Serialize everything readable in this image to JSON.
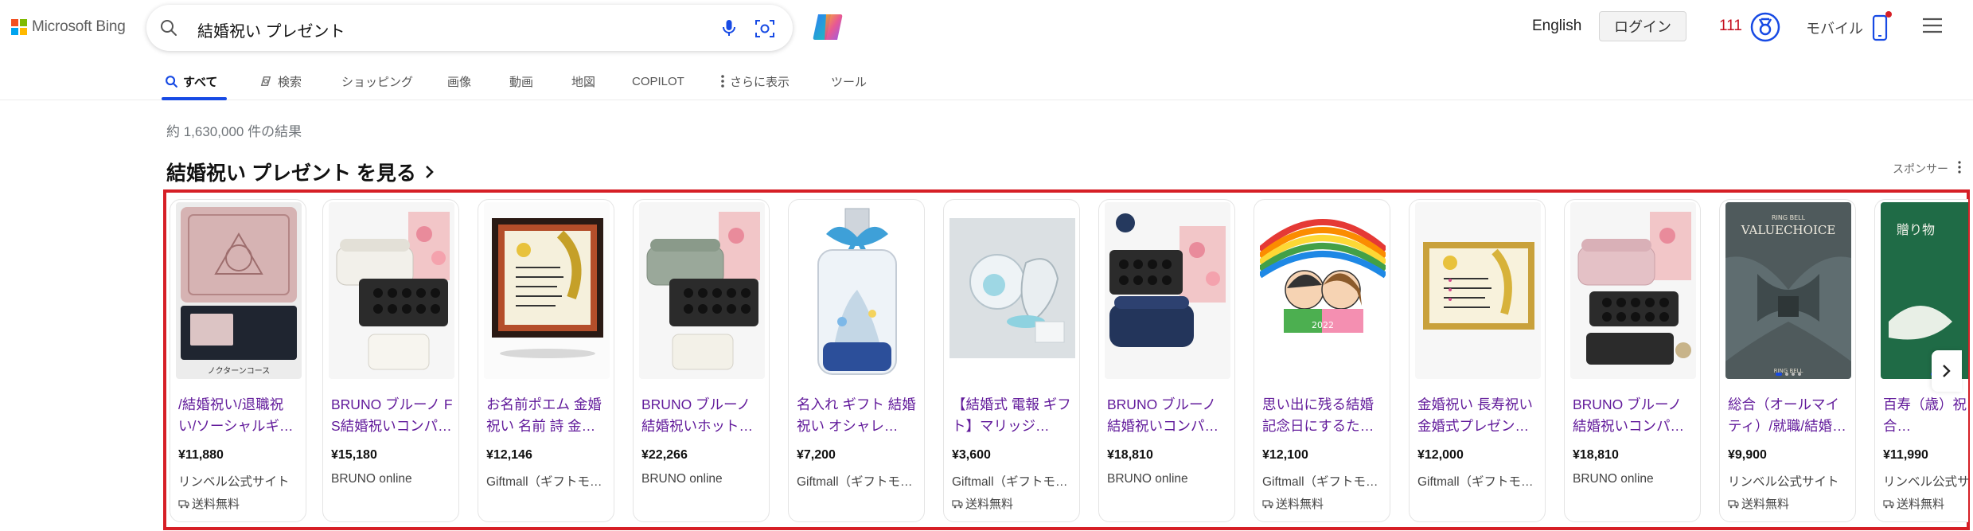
{
  "header": {
    "logo_text": "Microsoft Bing",
    "logo_colors": [
      "#f25022",
      "#7fba00",
      "#00a4ef",
      "#ffb900"
    ],
    "search_query": "結婚祝い プレゼント",
    "language_link": "English",
    "login_label": "ログイン",
    "rewards_count": "111",
    "mobile_label": "モバイル"
  },
  "tabs": [
    {
      "label": "すべて",
      "icon": "search-icon",
      "active": true
    },
    {
      "label": "検索",
      "icon": "copilot-search-icon",
      "active": false
    },
    {
      "label": "ショッピング",
      "icon": "",
      "active": false
    },
    {
      "label": "画像",
      "icon": "",
      "active": false
    },
    {
      "label": "動画",
      "icon": "",
      "active": false
    },
    {
      "label": "地図",
      "icon": "",
      "active": false
    },
    {
      "label": "COPILOT",
      "icon": "",
      "active": false
    },
    {
      "label": "さらに表示",
      "icon": "more-vertical-icon",
      "active": false
    },
    {
      "label": "ツール",
      "icon": "",
      "active": false
    }
  ],
  "results": {
    "count_text": "約 1,630,000 件の結果",
    "shopping_title": "結婚祝い プレゼント を見る",
    "sponsor_label": "スポンサー"
  },
  "products": [
    {
      "title": "/結婚祝い/退職祝い/ソーシャルギフト…",
      "price": "¥11,880",
      "seller": "リンベル公式サイト",
      "shipping": "送料無料",
      "image": "pink-gift-box-catalog"
    },
    {
      "title": "BRUNO ブルーノ FS結婚祝いコンパクト…",
      "price": "¥15,180",
      "seller": "BRUNO online",
      "shipping": "",
      "image": "white-hotplate"
    },
    {
      "title": "お名前ポエム 金婚祝い 名前 詩 金婚式…",
      "price": "¥12,146",
      "seller": "Giftmall（ギフトモール）",
      "shipping": "",
      "image": "name-poem-frame"
    },
    {
      "title": "BRUNO ブルーノ 結婚祝いホットプレート…",
      "price": "¥22,266",
      "seller": "BRUNO online",
      "shipping": "",
      "image": "green-hotplate"
    },
    {
      "title": "名入れ ギフト 結婚祝い オシャレ…",
      "price": "¥7,200",
      "seller": "Giftmall（ギフトモール）",
      "shipping": "",
      "image": "herbarium-bottle"
    },
    {
      "title": "【結婚式 電報 ギフト】マリッジ…",
      "price": "¥3,600",
      "seller": "Giftmall（ギフトモール）",
      "shipping": "送料無料",
      "image": "balloon-telegram"
    },
    {
      "title": "BRUNO ブルーノ 結婚祝いコンパクト…",
      "price": "¥18,810",
      "seller": "BRUNO online",
      "shipping": "",
      "image": "navy-hotplate"
    },
    {
      "title": "思い出に残る結婚記念日にするための…",
      "price": "¥12,100",
      "seller": "Giftmall（ギフトモール）",
      "shipping": "送料無料",
      "image": "portrait-illustration"
    },
    {
      "title": "金婚祝い 長寿祝い 金婚式プレゼント…",
      "price": "¥12,000",
      "seller": "Giftmall（ギフトモール）",
      "shipping": "",
      "image": "gold-frame-poem"
    },
    {
      "title": "BRUNO ブルーノ 結婚祝いコンパクト…",
      "price": "¥18,810",
      "seller": "BRUNO online",
      "shipping": "",
      "image": "pink-hotplate"
    },
    {
      "title": "総合（オールマイティ）/就職/結婚祝い…",
      "price": "¥9,900",
      "seller": "リンベル公式サイト",
      "shipping": "送料無料",
      "image": "ringbell-catalog",
      "image_text": "VALUECHOICE",
      "image_brand": "RING BELL"
    },
    {
      "title": "百寿（歳）祝い/総合…",
      "price": "¥11,990",
      "seller": "リンベル公式サイト",
      "shipping": "送料無料",
      "image": "green-gift-catalog",
      "image_text": "贈り物"
    }
  ],
  "colors": {
    "accent_blue": "#174ae4",
    "title_purple": "#621b9b",
    "highlight_red": "#d61f26",
    "rewards_red": "#c50f1f"
  }
}
